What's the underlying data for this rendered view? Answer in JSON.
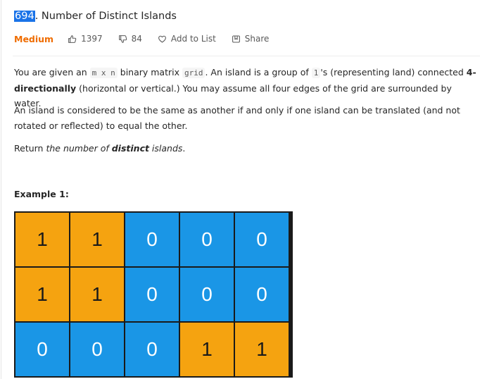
{
  "problem": {
    "number": "694",
    "title_rest": ". Number of Distinct Islands",
    "difficulty": "Medium",
    "likes": "1397",
    "dislikes": "84",
    "add_to_list": "Add to List",
    "share": "Share"
  },
  "description": {
    "p1_a": "You are given an ",
    "p1_code1": "m x n",
    "p1_b": " binary matrix ",
    "p1_code2": "grid",
    "p1_c": ". An island is a group of ",
    "p1_code3": "1",
    "p1_d": "'s (representing land) connected ",
    "p1_bold": "4-directionally",
    "p1_e": " (horizontal or vertical.) You may assume all four edges of the grid are surrounded by water.",
    "p2": "An island is considered to be the same as another if and only if one island can be translated (and not rotated or reflected) to equal the other.",
    "p3_a": "Return ",
    "p3_i1": "the number of ",
    "p3_bold": "distinct",
    "p3_i2": " islands",
    "p3_b": "."
  },
  "example": {
    "label": "Example 1:",
    "grid": [
      [
        "1",
        "1",
        "0",
        "0",
        "0"
      ],
      [
        "1",
        "1",
        "0",
        "0",
        "0"
      ],
      [
        "0",
        "0",
        "0",
        "1",
        "1"
      ]
    ],
    "colors": {
      "land": "#f5a310",
      "water": "#1a96e6"
    }
  },
  "icons": {
    "like": "thumbs-up-icon",
    "dislike": "thumbs-down-icon",
    "add": "heart-icon",
    "share": "share-icon"
  }
}
